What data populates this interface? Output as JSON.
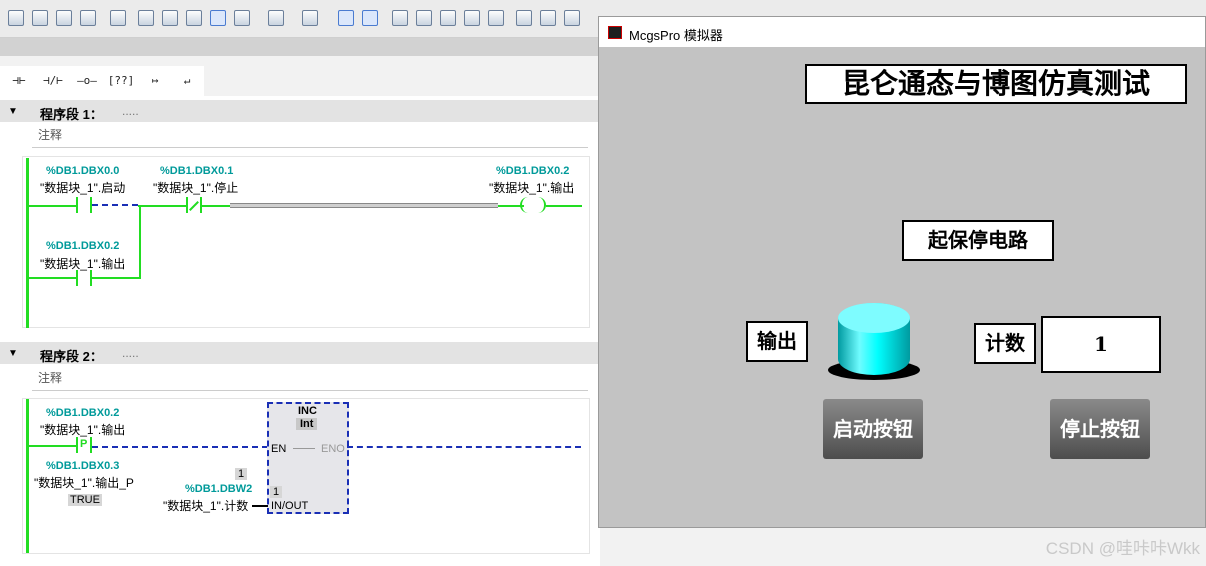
{
  "ladder_toolbar": [
    "⊣⊢",
    "⊣/⊢",
    "–o–",
    "[??]",
    "↦",
    "↵"
  ],
  "segments": [
    {
      "title": "程序段 1：",
      "dots": ".....",
      "comment": "注释",
      "contacts": [
        {
          "addr": "%DB1.DBX0.0",
          "sym": "\"数据块_1\".启动"
        },
        {
          "addr": "%DB1.DBX0.1",
          "sym": "\"数据块_1\".停止"
        },
        {
          "addr": "%DB1.DBX0.2",
          "sym": "\"数据块_1\".输出"
        },
        {
          "addr": "%DB1.DBX0.2",
          "sym": "\"数据块_1\".输出"
        }
      ]
    },
    {
      "title": "程序段 2：",
      "dots": ".....",
      "comment": "注释",
      "contact": {
        "addr": "%DB1.DBX0.2",
        "sym": "\"数据块_1\".输出",
        "tag": "P"
      },
      "edge": {
        "addr": "%DB1.DBX0.3",
        "sym": "\"数据块_1\".输出_P",
        "val": "TRUE"
      },
      "block": {
        "name": "INC",
        "type": "Int",
        "en": "EN",
        "eno": "ENO",
        "count_const": "1",
        "inout_val": "1",
        "inout": "IN/OUT",
        "operand_addr": "%DB1.DBW2",
        "operand_sym": "\"数据块_1\".计数"
      }
    }
  ],
  "simulator": {
    "title": "McgsPro 模拟器",
    "heading": "昆仑通态与博图仿真测试",
    "subheading": "起保停电路",
    "output_label": "输出",
    "count_label": "计数",
    "count_value": "1",
    "start_button": "启动按钮",
    "stop_button": "停止按钮",
    "lamp_state": "on",
    "lamp_color": "#00ffff"
  },
  "watermark": "CSDN @哇咔咔Wkk"
}
